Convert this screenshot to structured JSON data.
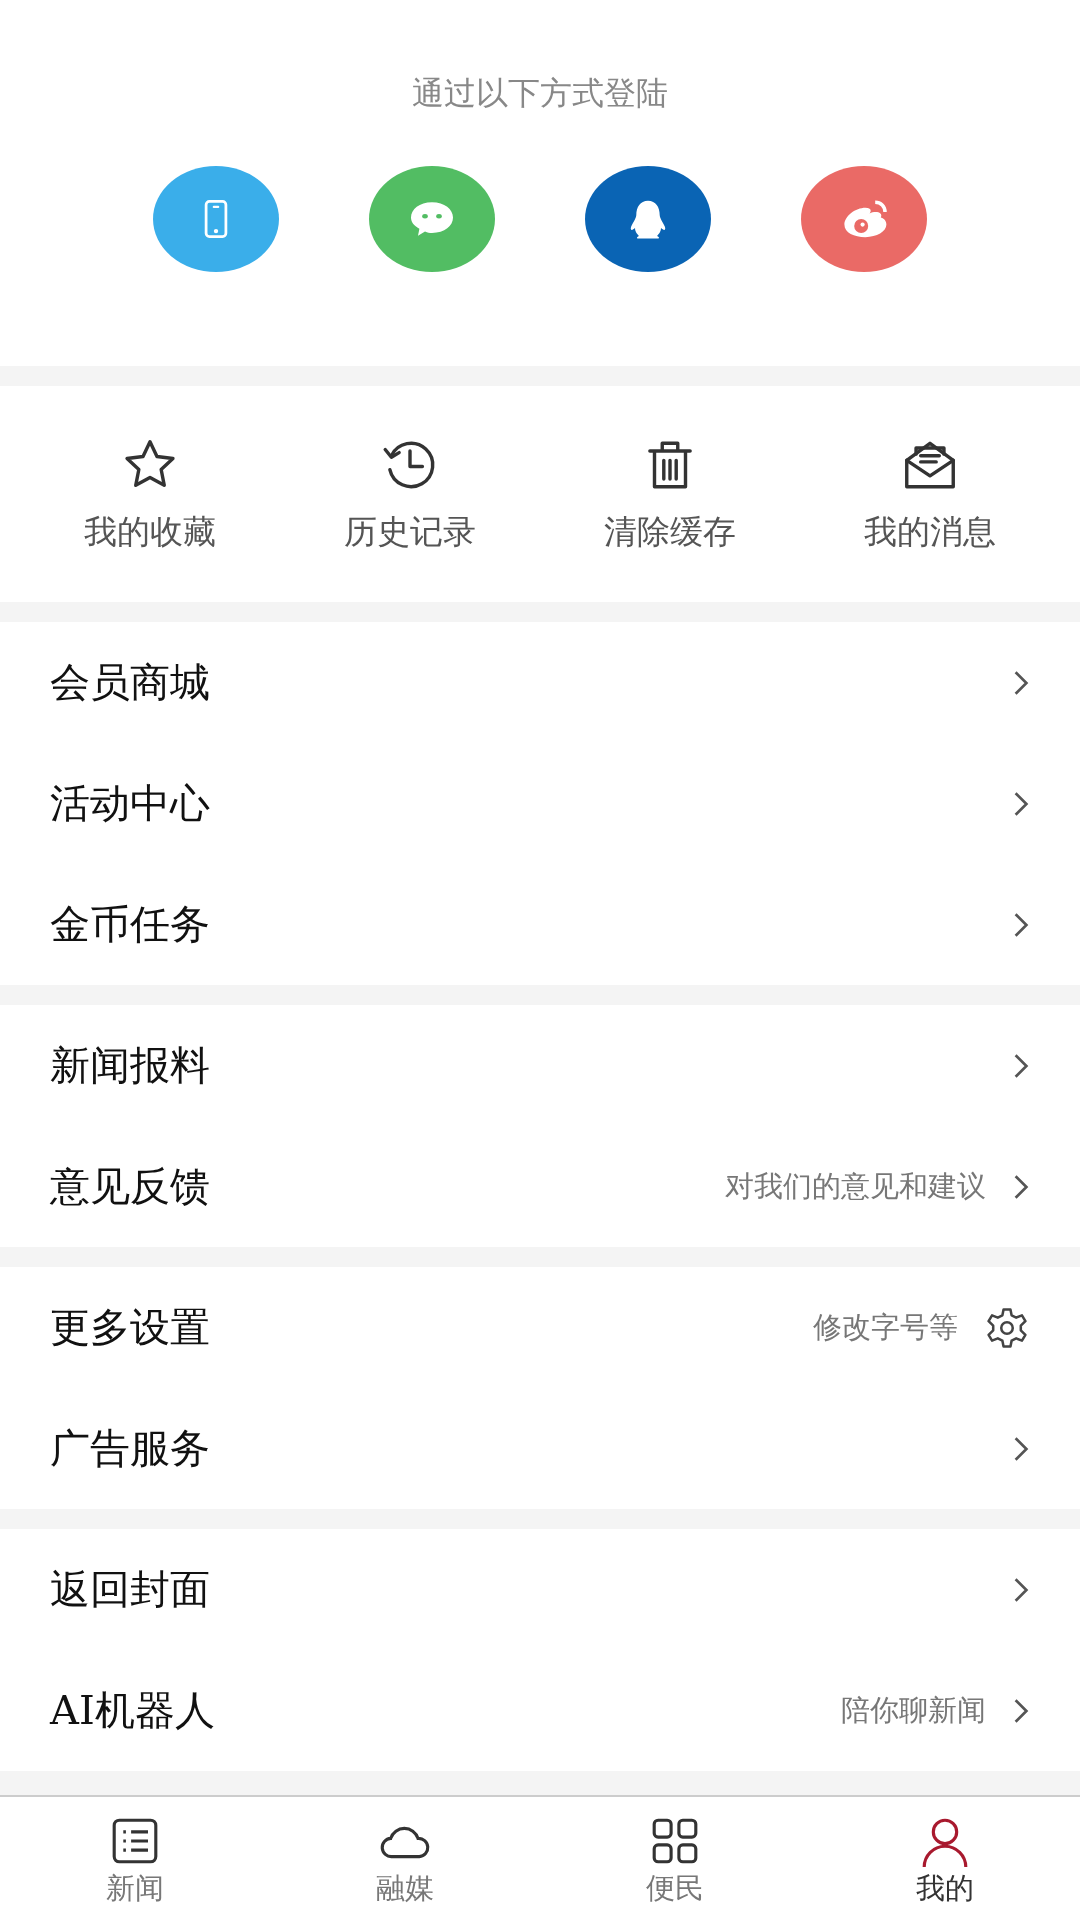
{
  "login": {
    "title": "通过以下方式登陆",
    "methods": [
      {
        "kind": "phone",
        "color": "#3aaeea"
      },
      {
        "kind": "wechat",
        "color": "#52bd63"
      },
      {
        "kind": "qq",
        "color": "#0a64b4"
      },
      {
        "kind": "weibo",
        "color": "#ea6a66"
      }
    ]
  },
  "quick_actions": [
    {
      "kind": "star",
      "label": "我的收藏"
    },
    {
      "kind": "history",
      "label": "历史记录"
    },
    {
      "kind": "trash",
      "label": "清除缓存"
    },
    {
      "kind": "mail",
      "label": "我的消息"
    }
  ],
  "menu_groups": [
    [
      {
        "label": "会员商城",
        "kind": "chevron"
      },
      {
        "label": "活动中心",
        "kind": "chevron"
      },
      {
        "label": "金币任务",
        "kind": "chevron"
      }
    ],
    [
      {
        "label": "新闻报料",
        "kind": "chevron"
      },
      {
        "label": "意见反馈",
        "hint": "对我们的意见和建议",
        "kind": "chevron"
      }
    ],
    [
      {
        "label": "更多设置",
        "hint": "修改字号等",
        "kind": "gear"
      },
      {
        "label": "广告服务",
        "kind": "chevron"
      }
    ],
    [
      {
        "label": "返回封面",
        "kind": "chevron"
      },
      {
        "label": "AI机器人",
        "hint": "陪你聊新闻",
        "kind": "chevron"
      }
    ]
  ],
  "tab_bar": [
    {
      "kind": "list",
      "label": "新闻",
      "selected": false
    },
    {
      "kind": "cloud",
      "label": "融媒",
      "selected": false
    },
    {
      "kind": "grid",
      "label": "便民",
      "selected": false
    },
    {
      "kind": "person",
      "label": "我的",
      "selected": true
    }
  ]
}
